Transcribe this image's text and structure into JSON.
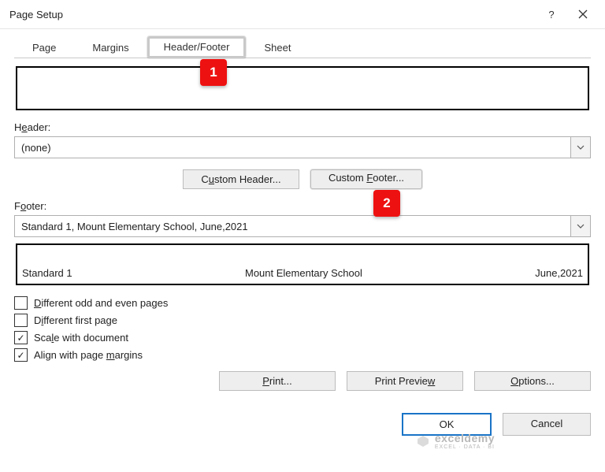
{
  "titlebar": {
    "title": "Page Setup"
  },
  "tabs": {
    "page": "Page",
    "margins": "Margins",
    "header_footer": "Header/Footer",
    "sheet": "Sheet"
  },
  "callouts": {
    "one": "1",
    "two": "2"
  },
  "header": {
    "label_pre": "H",
    "label_u": "e",
    "label_post": "ader:",
    "value": "(none)"
  },
  "buttons": {
    "custom_header_pre": "C",
    "custom_header_u": "u",
    "custom_header_post": "stom Header...",
    "custom_footer_pre": "Custom ",
    "custom_footer_u": "F",
    "custom_footer_post": "ooter..."
  },
  "footer": {
    "label_pre": "F",
    "label_u": "o",
    "label_post": "oter:",
    "value": "Standard 1, Mount Elementary School, June,2021",
    "left": "Standard 1",
    "center": "Mount Elementary School",
    "right": "June,2021"
  },
  "checks": {
    "diff_odd_pre": "",
    "diff_odd_u": "D",
    "diff_odd_post": "ifferent odd and even pages",
    "diff_first_pre": "D",
    "diff_first_u": "i",
    "diff_first_post": "fferent first page",
    "scale_pre": "Sca",
    "scale_u": "l",
    "scale_post": "e with document",
    "align_pre": "Align with page ",
    "align_u": "m",
    "align_post": "argins"
  },
  "actions": {
    "print_pre": "",
    "print_u": "P",
    "print_post": "rint...",
    "preview_pre": "Print Previe",
    "preview_u": "w",
    "preview_post": "",
    "options_pre": "",
    "options_u": "O",
    "options_post": "ptions..."
  },
  "ok": {
    "ok": "OK",
    "cancel": "Cancel"
  },
  "watermark": {
    "brand": "exceldemy",
    "tag": "EXCEL · DATA · BI"
  }
}
